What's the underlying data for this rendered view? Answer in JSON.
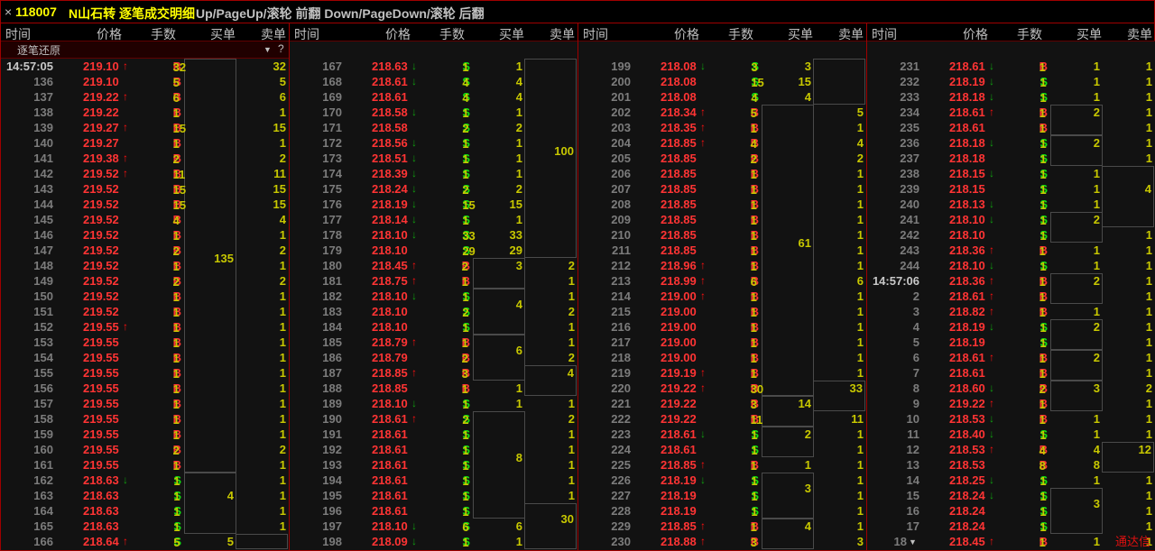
{
  "title": {
    "close": "×",
    "code": "118007",
    "name": "N山石转 逐笔成交明细",
    "hint": "Up/PageUp/滚轮 前翻 Down/PageDown/滚轮 后翻"
  },
  "columns": [
    "时间",
    "价格",
    "手数",
    "买单",
    "卖单"
  ],
  "subbar": {
    "label": "逐笔还原",
    "filter_icon": "▼",
    "help": "?"
  },
  "watermark": "通达信",
  "colors": {
    "price": "#ff3434",
    "buy": "#ff3434",
    "sell": "#10e010",
    "volume": "#c8c800",
    "border": "#a00000"
  },
  "panels": [
    {
      "rows": [
        [
          "14:57:05",
          "219.10",
          "u",
          "32",
          "B",
          "",
          "32"
        ],
        [
          "136",
          "219.10",
          "",
          "5",
          "B",
          "",
          "5"
        ],
        [
          "137",
          "219.22",
          "u",
          "6",
          "B",
          "",
          "6"
        ],
        [
          "138",
          "219.22",
          "",
          "1",
          "B",
          "",
          "1"
        ],
        [
          "139",
          "219.27",
          "u",
          "15",
          "B",
          "",
          "15"
        ],
        [
          "140",
          "219.27",
          "",
          "1",
          "B",
          "",
          "1"
        ],
        [
          "141",
          "219.38",
          "u",
          "2",
          "B",
          "",
          "2"
        ],
        [
          "142",
          "219.52",
          "u",
          "11",
          "B",
          "",
          "11"
        ],
        [
          "143",
          "219.52",
          "",
          "15",
          "B",
          "",
          "15"
        ],
        [
          "144",
          "219.52",
          "",
          "15",
          "B",
          "",
          "15"
        ],
        [
          "145",
          "219.52",
          "",
          "4",
          "B",
          "",
          "4"
        ],
        [
          "146",
          "219.52",
          "",
          "1",
          "B",
          "",
          "1"
        ],
        [
          "147",
          "219.52",
          "",
          "2",
          "B",
          "",
          "2"
        ],
        [
          "148",
          "219.52",
          "",
          "1",
          "B",
          "",
          "1"
        ],
        [
          "149",
          "219.52",
          "",
          "2",
          "B",
          "",
          "2"
        ],
        [
          "150",
          "219.52",
          "",
          "1",
          "B",
          "",
          "1"
        ],
        [
          "151",
          "219.52",
          "",
          "1",
          "B",
          "",
          "1"
        ],
        [
          "152",
          "219.55",
          "u",
          "1",
          "B",
          "",
          "1"
        ],
        [
          "153",
          "219.55",
          "",
          "1",
          "B",
          "",
          "1"
        ],
        [
          "154",
          "219.55",
          "",
          "1",
          "B",
          "",
          "1"
        ],
        [
          "155",
          "219.55",
          "",
          "1",
          "B",
          "",
          "1"
        ],
        [
          "156",
          "219.55",
          "",
          "1",
          "B",
          "",
          "1"
        ],
        [
          "157",
          "219.55",
          "",
          "1",
          "B",
          "",
          "1"
        ],
        [
          "158",
          "219.55",
          "",
          "1",
          "B",
          "",
          "1"
        ],
        [
          "159",
          "219.55",
          "",
          "1",
          "B",
          "",
          "1"
        ],
        [
          "160",
          "219.55",
          "",
          "2",
          "B",
          "",
          "2"
        ],
        [
          "161",
          "219.55",
          "",
          "1",
          "B",
          "",
          "1"
        ],
        [
          "162",
          "218.63",
          "d",
          "1",
          "S",
          "",
          "1"
        ],
        [
          "163",
          "218.63",
          "",
          "1",
          "S",
          "",
          "1"
        ],
        [
          "164",
          "218.63",
          "",
          "1",
          "S",
          "",
          "1"
        ],
        [
          "165",
          "218.63",
          "",
          "1",
          "S",
          "",
          "1"
        ],
        [
          "166",
          "218.64",
          "u",
          "5",
          "S",
          "5",
          ""
        ]
      ],
      "buyBoxes": [
        [
          0,
          26,
          "135"
        ],
        [
          27,
          30,
          "4"
        ]
      ],
      "sellBoxes": [
        [
          31,
          31,
          ""
        ]
      ]
    },
    {
      "rows": [
        [
          "167",
          "218.63",
          "d",
          "1",
          "S",
          "1",
          ""
        ],
        [
          "168",
          "218.61",
          "d",
          "4",
          "S",
          "4",
          ""
        ],
        [
          "169",
          "218.61",
          "",
          "4",
          "S",
          "4",
          ""
        ],
        [
          "170",
          "218.58",
          "d",
          "1",
          "S",
          "1",
          ""
        ],
        [
          "171",
          "218.58",
          "",
          "2",
          "S",
          "2",
          ""
        ],
        [
          "172",
          "218.56",
          "d",
          "1",
          "S",
          "1",
          ""
        ],
        [
          "173",
          "218.51",
          "d",
          "1",
          "S",
          "1",
          ""
        ],
        [
          "174",
          "218.39",
          "d",
          "1",
          "S",
          "1",
          ""
        ],
        [
          "175",
          "218.24",
          "d",
          "2",
          "S",
          "2",
          ""
        ],
        [
          "176",
          "218.19",
          "d",
          "15",
          "S",
          "15",
          ""
        ],
        [
          "177",
          "218.14",
          "d",
          "1",
          "S",
          "1",
          ""
        ],
        [
          "178",
          "218.10",
          "d",
          "33",
          "S",
          "33",
          ""
        ],
        [
          "179",
          "218.10",
          "",
          "29",
          "S",
          "29",
          ""
        ],
        [
          "180",
          "218.45",
          "u",
          "2",
          "B",
          "",
          "2"
        ],
        [
          "181",
          "218.75",
          "u",
          "1",
          "B",
          "",
          "1"
        ],
        [
          "182",
          "218.10",
          "d",
          "1",
          "S",
          "",
          "1"
        ],
        [
          "183",
          "218.10",
          "",
          "2",
          "S",
          "",
          "2"
        ],
        [
          "184",
          "218.10",
          "",
          "1",
          "S",
          "",
          "1"
        ],
        [
          "185",
          "218.79",
          "u",
          "1",
          "B",
          "",
          "1"
        ],
        [
          "186",
          "218.79",
          "",
          "2",
          "B",
          "",
          "2"
        ],
        [
          "187",
          "218.85",
          "u",
          "3",
          "B",
          "",
          ""
        ],
        [
          "188",
          "218.85",
          "",
          "1",
          "B",
          "1",
          ""
        ],
        [
          "189",
          "218.10",
          "d",
          "1",
          "S",
          "1",
          "1"
        ],
        [
          "190",
          "218.61",
          "u",
          "2",
          "S",
          "",
          "2"
        ],
        [
          "191",
          "218.61",
          "",
          "1",
          "S",
          "",
          "1"
        ],
        [
          "192",
          "218.61",
          "",
          "1",
          "S",
          "",
          "1"
        ],
        [
          "193",
          "218.61",
          "",
          "1",
          "S",
          "",
          "1"
        ],
        [
          "194",
          "218.61",
          "",
          "1",
          "S",
          "",
          "1"
        ],
        [
          "195",
          "218.61",
          "",
          "1",
          "S",
          "",
          "1"
        ],
        [
          "196",
          "218.61",
          "",
          "1",
          "S",
          "",
          ""
        ],
        [
          "197",
          "218.10",
          "d",
          "6",
          "S",
          "6",
          ""
        ],
        [
          "198",
          "218.09",
          "d",
          "1",
          "S",
          "1",
          ""
        ]
      ],
      "buyBoxes": [
        [
          13,
          14,
          "3"
        ],
        [
          15,
          17,
          "4"
        ],
        [
          18,
          20,
          "6"
        ],
        [
          23,
          29,
          "8"
        ]
      ],
      "sellBoxes": [
        [
          0,
          12,
          "100"
        ],
        [
          20,
          21,
          "4"
        ],
        [
          29,
          31,
          "30"
        ]
      ]
    },
    {
      "rows": [
        [
          "199",
          "218.08",
          "d",
          "3",
          "S",
          "3",
          ""
        ],
        [
          "200",
          "218.08",
          "",
          "15",
          "S",
          "15",
          ""
        ],
        [
          "201",
          "218.08",
          "",
          "4",
          "S",
          "4",
          ""
        ],
        [
          "202",
          "218.34",
          "u",
          "5",
          "B",
          "",
          "5"
        ],
        [
          "203",
          "218.35",
          "u",
          "1",
          "B",
          "",
          "1"
        ],
        [
          "204",
          "218.85",
          "u",
          "4",
          "B",
          "",
          "4"
        ],
        [
          "205",
          "218.85",
          "",
          "2",
          "B",
          "",
          "2"
        ],
        [
          "206",
          "218.85",
          "",
          "1",
          "B",
          "",
          "1"
        ],
        [
          "207",
          "218.85",
          "",
          "1",
          "B",
          "",
          "1"
        ],
        [
          "208",
          "218.85",
          "",
          "1",
          "B",
          "",
          "1"
        ],
        [
          "209",
          "218.85",
          "",
          "1",
          "B",
          "",
          "1"
        ],
        [
          "210",
          "218.85",
          "",
          "1",
          "B",
          "",
          "1"
        ],
        [
          "211",
          "218.85",
          "",
          "1",
          "B",
          "",
          "1"
        ],
        [
          "212",
          "218.96",
          "u",
          "1",
          "B",
          "",
          "1"
        ],
        [
          "213",
          "218.99",
          "u",
          "6",
          "B",
          "",
          "6"
        ],
        [
          "214",
          "219.00",
          "u",
          "1",
          "B",
          "",
          "1"
        ],
        [
          "215",
          "219.00",
          "",
          "1",
          "B",
          "",
          "1"
        ],
        [
          "216",
          "219.00",
          "",
          "1",
          "B",
          "",
          "1"
        ],
        [
          "217",
          "219.00",
          "",
          "1",
          "B",
          "",
          "1"
        ],
        [
          "218",
          "219.00",
          "",
          "1",
          "B",
          "",
          "1"
        ],
        [
          "219",
          "219.19",
          "u",
          "1",
          "B",
          "",
          "1"
        ],
        [
          "220",
          "219.22",
          "u",
          "30",
          "B",
          "",
          ""
        ],
        [
          "221",
          "219.22",
          "",
          "3",
          "B",
          "",
          ""
        ],
        [
          "222",
          "219.22",
          "",
          "11",
          "B",
          "",
          "11"
        ],
        [
          "223",
          "218.61",
          "d",
          "1",
          "S",
          "",
          "1"
        ],
        [
          "224",
          "218.61",
          "",
          "1",
          "S",
          "",
          "1"
        ],
        [
          "225",
          "218.85",
          "u",
          "1",
          "B",
          "1",
          "1"
        ],
        [
          "226",
          "218.19",
          "d",
          "1",
          "S",
          "",
          "1"
        ],
        [
          "227",
          "218.19",
          "",
          "1",
          "S",
          "",
          "1"
        ],
        [
          "228",
          "218.19",
          "",
          "1",
          "S",
          "",
          "1"
        ],
        [
          "229",
          "218.85",
          "u",
          "1",
          "B",
          "",
          "1"
        ],
        [
          "230",
          "218.88",
          "u",
          "3",
          "B",
          "",
          "3"
        ]
      ],
      "buyBoxes": [
        [
          3,
          21,
          "61"
        ],
        [
          22,
          23,
          "14"
        ],
        [
          24,
          25,
          "2"
        ],
        [
          27,
          29,
          "3"
        ],
        [
          30,
          31,
          "4"
        ]
      ],
      "sellBoxes": [
        [
          0,
          2,
          ""
        ],
        [
          21,
          22,
          "33"
        ]
      ]
    },
    {
      "rows": [
        [
          "231",
          "218.61",
          "d",
          "1",
          "B",
          "1",
          "1"
        ],
        [
          "232",
          "218.19",
          "d",
          "1",
          "S",
          "1",
          "1"
        ],
        [
          "233",
          "218.18",
          "d",
          "1",
          "S",
          "1",
          "1"
        ],
        [
          "234",
          "218.61",
          "u",
          "1",
          "B",
          "",
          "1"
        ],
        [
          "235",
          "218.61",
          "",
          "1",
          "B",
          "",
          "1"
        ],
        [
          "236",
          "218.18",
          "d",
          "1",
          "S",
          "",
          "1"
        ],
        [
          "237",
          "218.18",
          "",
          "1",
          "S",
          "",
          "1"
        ],
        [
          "238",
          "218.15",
          "d",
          "1",
          "S",
          "1",
          ""
        ],
        [
          "239",
          "218.15",
          "",
          "1",
          "S",
          "1",
          ""
        ],
        [
          "240",
          "218.13",
          "d",
          "1",
          "S",
          "1",
          ""
        ],
        [
          "241",
          "218.10",
          "d",
          "1",
          "S",
          "",
          ""
        ],
        [
          "242",
          "218.10",
          "",
          "1",
          "S",
          "",
          "1"
        ],
        [
          "243",
          "218.36",
          "u",
          "1",
          "B",
          "1",
          "1"
        ],
        [
          "244",
          "218.10",
          "d",
          "1",
          "S",
          "1",
          "1"
        ],
        [
          "14:57:06",
          "218.36",
          "u",
          "1",
          "B",
          "",
          "1"
        ],
        [
          "2",
          "218.61",
          "u",
          "1",
          "B",
          "",
          "1"
        ],
        [
          "3",
          "218.82",
          "u",
          "1",
          "B",
          "1",
          "1"
        ],
        [
          "4",
          "218.19",
          "d",
          "1",
          "S",
          "",
          "1"
        ],
        [
          "5",
          "218.19",
          "",
          "1",
          "S",
          "",
          "1"
        ],
        [
          "6",
          "218.61",
          "u",
          "1",
          "B",
          "",
          "1"
        ],
        [
          "7",
          "218.61",
          "",
          "1",
          "B",
          "",
          "1"
        ],
        [
          "8",
          "218.60",
          "d",
          "2",
          "B",
          "",
          "2"
        ],
        [
          "9",
          "219.22",
          "u",
          "1",
          "B",
          "",
          "1"
        ],
        [
          "10",
          "218.53",
          "d",
          "1",
          "B",
          "1",
          "1"
        ],
        [
          "11",
          "218.40",
          "d",
          "1",
          "S",
          "1",
          "1"
        ],
        [
          "12",
          "218.53",
          "u",
          "4",
          "B",
          "4",
          ""
        ],
        [
          "13",
          "218.53",
          "",
          "8",
          "B",
          "8",
          ""
        ],
        [
          "14",
          "218.25",
          "d",
          "1",
          "S",
          "1",
          "1"
        ],
        [
          "15",
          "218.24",
          "d",
          "1",
          "S",
          "",
          "1"
        ],
        [
          "16",
          "218.24",
          "",
          "1",
          "S",
          "",
          "1"
        ],
        [
          "17",
          "218.24",
          "",
          "1",
          "S",
          "",
          "1"
        ],
        [
          "18",
          "218.45",
          "u",
          "1",
          "B",
          "1",
          "1"
        ]
      ],
      "buyBoxes": [
        [
          3,
          4,
          "2"
        ],
        [
          5,
          6,
          "2"
        ],
        [
          10,
          11,
          "2"
        ],
        [
          14,
          15,
          "2"
        ],
        [
          17,
          18,
          "2"
        ],
        [
          19,
          20,
          "2"
        ],
        [
          21,
          22,
          "3"
        ],
        [
          28,
          30,
          "3"
        ]
      ],
      "sellBoxes": [
        [
          7,
          10,
          "4"
        ],
        [
          25,
          26,
          "12"
        ]
      ],
      "lastRowCaret": true
    }
  ]
}
